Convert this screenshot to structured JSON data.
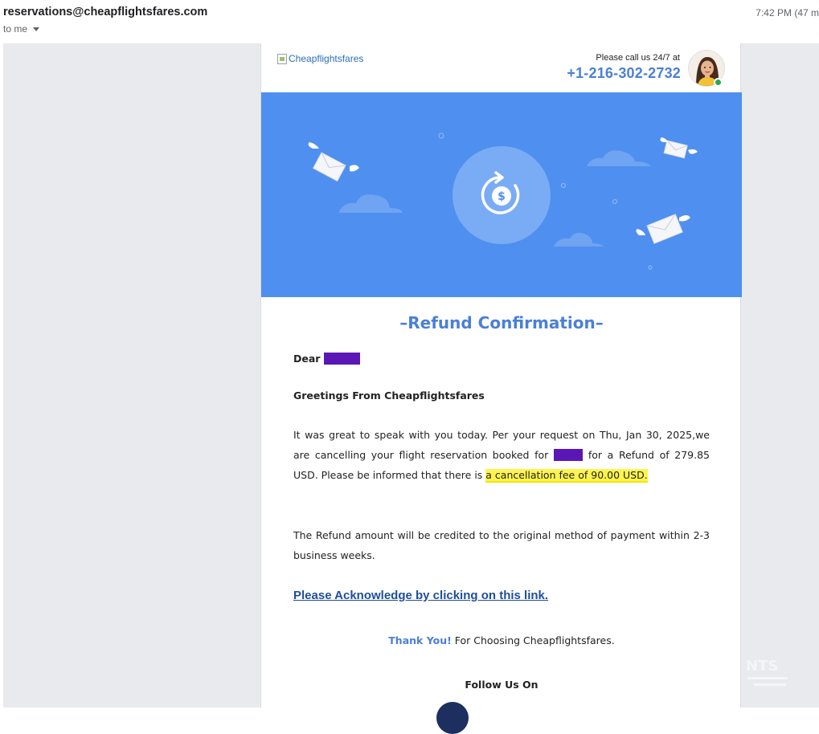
{
  "message": {
    "sender": "reservations@cheapflightsfares.com",
    "recipient": "to me",
    "time": "7:42 PM (47 m"
  },
  "email": {
    "logo_alt": "Cheapflightsfares",
    "call_label": "Please call us 24/7 at",
    "phone": "+1-216-302-2732",
    "title": "Refund Confirmation",
    "dear_prefix": "Dear ",
    "dear_name": "XXXX,",
    "greeting": "Greetings From Cheapflightsfares",
    "para1_a": "It was great to speak with you today. Per your request on Thu, Jan 30, 2025,we are cancelling your flight reservation booked for ",
    "para1_name": "XXXX",
    "para1_b": " for a Refund of 279.85 USD. Please be informed that there is ",
    "para1_highlight": "a cancellation fee of 90.00 USD.",
    "para2": "The Refund amount will be credited to the original method of payment within 2-3 business weeks.",
    "ack_link": "Please Acknowledge by clicking on this link.",
    "thank_you": "Thank You!",
    "thank_rest": " For Choosing Cheapflightsfares.",
    "follow": "Follow Us On"
  },
  "colors": {
    "hero": "#4f8ff0",
    "accent": "#4a7fd8",
    "link": "#1f4e99",
    "redaction": "#5b17b5",
    "highlight": "#fff44f"
  }
}
